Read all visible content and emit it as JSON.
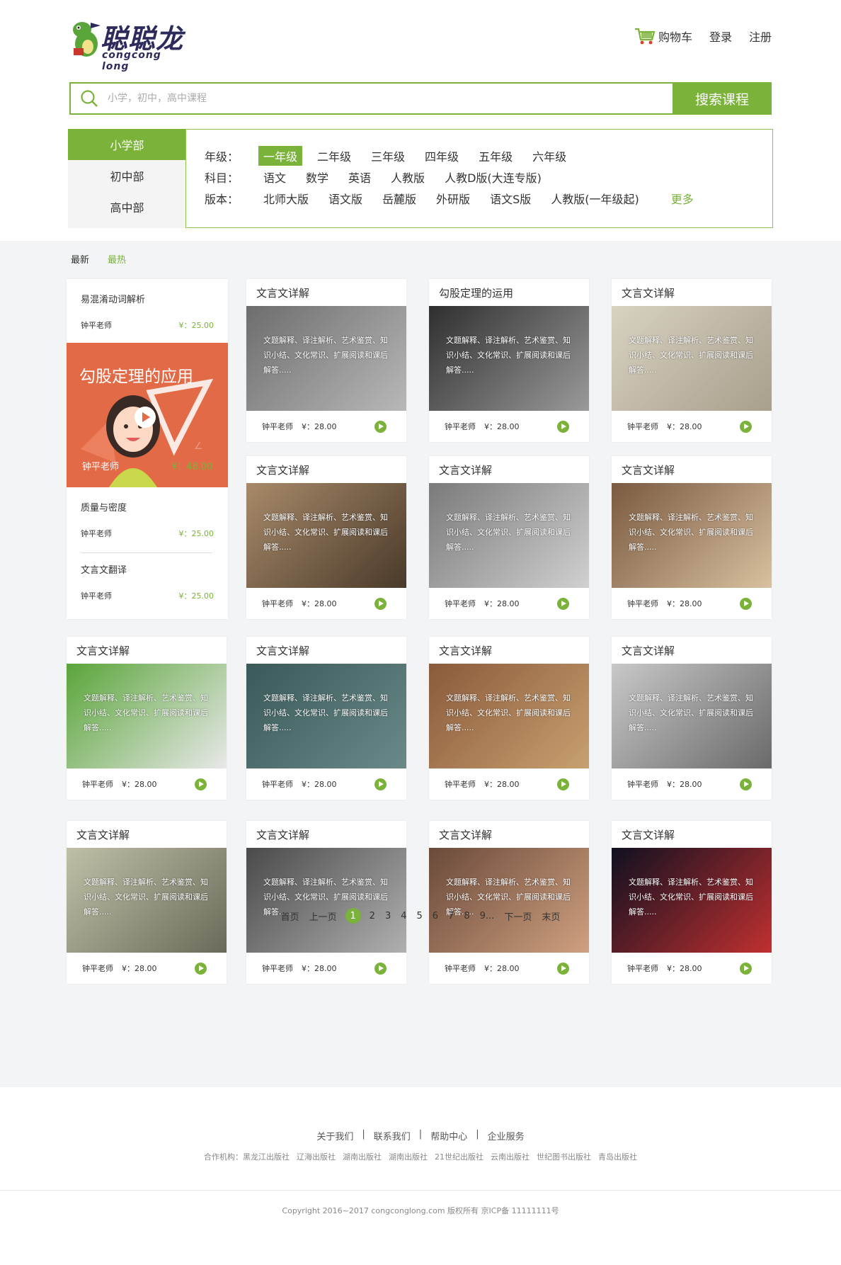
{
  "header": {
    "logo_cn": "聪聪龙",
    "logo_en": "congcong long",
    "cart": "购物车",
    "login": "登录",
    "register": "注册"
  },
  "search": {
    "placeholder": "小学，初中，高中课程",
    "button": "搜索课程"
  },
  "levels": [
    "小学部",
    "初中部",
    "高中部"
  ],
  "filters": {
    "grade_label": "年级：",
    "grades": [
      "一年级",
      "二年级",
      "三年级",
      "四年级",
      "五年级",
      "六年级"
    ],
    "subject_label": "科目：",
    "subjects": [
      "语文",
      "数学",
      "英语",
      "人教版",
      "人教D版(大连专版)"
    ],
    "edition_label": "版本：",
    "editions": [
      "北师大版",
      "语文版",
      "岳麓版",
      "外研版",
      "语文S版",
      "人教版(一年级起)"
    ],
    "more": "更多"
  },
  "sort": {
    "newest": "最新",
    "hottest": "最热"
  },
  "rank": {
    "items": [
      {
        "title": "易混淆动词解析",
        "teacher": "钟平老师",
        "price": "¥：25.00"
      },
      {
        "title": "质量与密度",
        "teacher": "钟平老师",
        "price": "¥：25.00"
      },
      {
        "title": "文言文翻译",
        "teacher": "钟平老师",
        "price": "¥：25.00"
      }
    ],
    "feature": {
      "title": "勾股定理的应用",
      "teacher": "钟平老师",
      "price": "¥：48.00"
    }
  },
  "course_desc": "文题解释、译注解析、艺术鉴赏、知识小结、文化常识、扩展阅读和课后解答.....",
  "courses": [
    {
      "title": "文言文详解",
      "teacher": "钟平老师",
      "price": "¥：28.00"
    },
    {
      "title": "勾股定理的运用",
      "teacher": "钟平老师",
      "price": "¥：28.00"
    },
    {
      "title": "文言文详解",
      "teacher": "钟平老师",
      "price": "¥：28.00"
    },
    {
      "title": "文言文详解",
      "teacher": "钟平老师",
      "price": "¥：28.00"
    },
    {
      "title": "文言文详解",
      "teacher": "钟平老师",
      "price": "¥：28.00"
    },
    {
      "title": "文言文详解",
      "teacher": "钟平老师",
      "price": "¥：28.00"
    },
    {
      "title": "文言文详解",
      "teacher": "钟平老师",
      "price": "¥：28.00"
    },
    {
      "title": "文言文详解",
      "teacher": "钟平老师",
      "price": "¥：28.00"
    },
    {
      "title": "文言文详解",
      "teacher": "钟平老师",
      "price": "¥：28.00"
    },
    {
      "title": "文言文详解",
      "teacher": "钟平老师",
      "price": "¥：28.00"
    },
    {
      "title": "文言文详解",
      "teacher": "钟平老师",
      "price": "¥：28.00"
    },
    {
      "title": "文言文详解",
      "teacher": "钟平老师",
      "price": "¥：28.00"
    },
    {
      "title": "文言文详解",
      "teacher": "钟平老师",
      "price": "¥：28.00"
    },
    {
      "title": "文言文详解",
      "teacher": "钟平老师",
      "price": "¥：28.00"
    },
    {
      "title": "文言文详解",
      "teacher": "钟平老师",
      "price": "¥：28.00"
    }
  ],
  "pager": {
    "first": "首页",
    "prev": "上一页",
    "pages": [
      "1",
      "2",
      "3",
      "4",
      "5",
      "6",
      "7",
      "8",
      "9..."
    ],
    "next": "下一页",
    "last": "末页"
  },
  "footer": {
    "links": [
      "关于我们",
      "联系我们",
      "帮助中心",
      "企业服务"
    ],
    "partners_label": "合作机构：",
    "partners": [
      "黑龙江出版社",
      "辽海出版社",
      "湖南出版社",
      "湖南出版社",
      "21世纪出版社",
      "云南出版社",
      "世纪图书出版社",
      "青岛出版社"
    ],
    "copyright": "Copyright 2016~2017 congconglong.com 版权所有 京ICP备 11111111号"
  },
  "colors": {
    "accent": "#7ab23a",
    "feature": "#e36a47"
  }
}
